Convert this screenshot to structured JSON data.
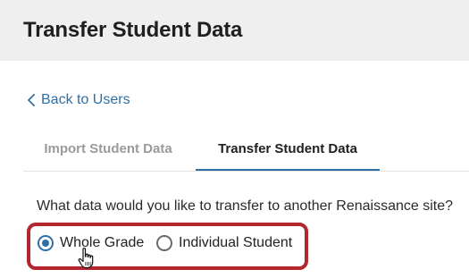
{
  "header": {
    "title": "Transfer Student Data"
  },
  "nav": {
    "back_label": "Back to Users",
    "back_icon": "chevron-left-icon"
  },
  "tabs": [
    {
      "label": "Import Student Data",
      "active": false
    },
    {
      "label": "Transfer Student Data",
      "active": true
    }
  ],
  "form": {
    "question": "What data would you like to transfer to another Renaissance site?",
    "options": [
      {
        "label": "Whole Grade",
        "selected": true
      },
      {
        "label": "Individual Student",
        "selected": false
      }
    ]
  },
  "colors": {
    "accent": "#2f6fa6",
    "highlight_border": "#b3262e",
    "header_bg": "#efefef",
    "inactive_tab": "#9a9a9a"
  },
  "cursor": {
    "icon": "hand-pointer-icon"
  }
}
